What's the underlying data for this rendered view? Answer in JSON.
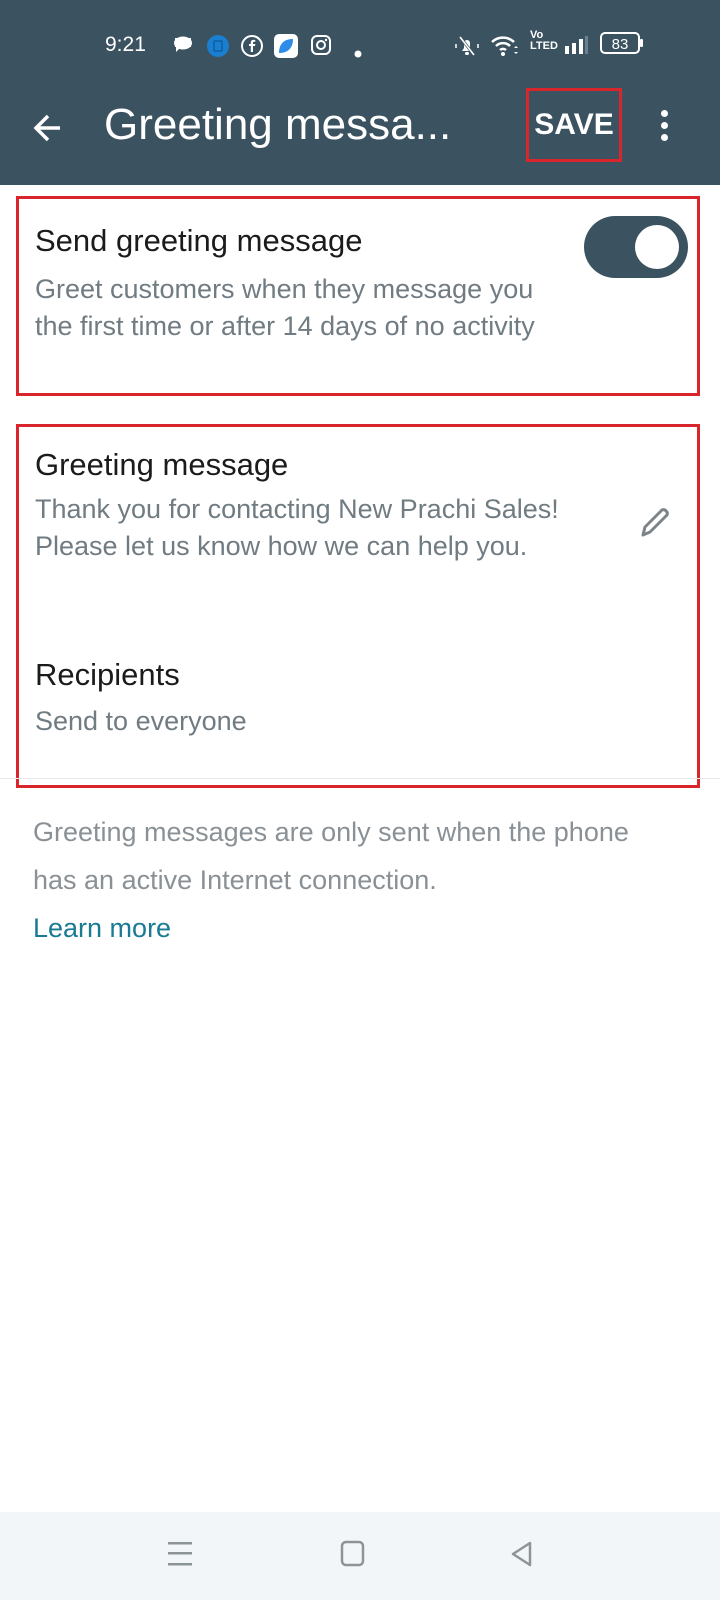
{
  "status_bar": {
    "time": "9:21",
    "battery": "83",
    "icons": [
      "chat-bubble-icon",
      "app-notification-icon",
      "facebook-icon",
      "app-icon",
      "instagram-icon",
      "dot-icon",
      "mute-icon",
      "wifi-icon",
      "volte-icon",
      "signal-icon",
      "battery-icon"
    ],
    "volte_label_top": "Vo",
    "volte_label_bottom": "LTED"
  },
  "app_bar": {
    "title": "Greeting messa...",
    "save_label": "SAVE",
    "back_icon": "arrow-left-icon",
    "more_icon": "more-vertical-icon"
  },
  "send_greeting": {
    "title": "Send greeting message",
    "description": "Greet customers when they message you the first time or after 14 days of no activity",
    "toggle_on": true,
    "accent_color": "#3b5260"
  },
  "greeting_message": {
    "title": "Greeting message",
    "text": "Thank you for contacting New Prachi Sales! Please let us know how we can help you.",
    "edit_icon": "pencil-icon"
  },
  "recipients": {
    "title": "Recipients",
    "value": "Send to everyone"
  },
  "footer": {
    "note": "Greeting messages are only sent when the phone has an active Internet connection.",
    "learn_more": "Learn more",
    "link_color": "#1a7a94"
  },
  "highlight_color": "#d9262c",
  "nav_bar": {
    "buttons": [
      "menu-icon",
      "home-icon",
      "back-triangle-icon"
    ]
  }
}
